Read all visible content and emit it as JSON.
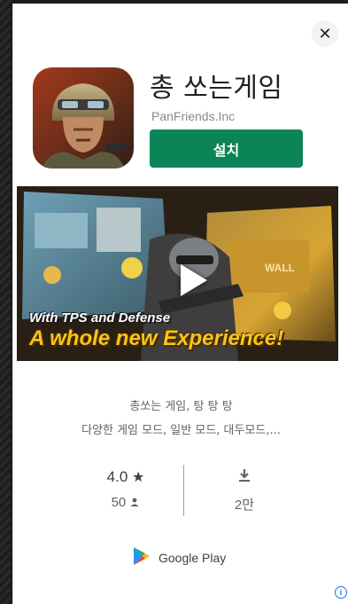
{
  "ad": {
    "close_glyph": "✕",
    "app_title": "총 쏘는게임",
    "developer": "PanFriends.Inc",
    "install_label": "설치",
    "video": {
      "tagline_line1": "With TPS and Defense",
      "tagline_line2": "A whole new Experience!"
    },
    "description_line1": "총쏘는 게임, 탕 탕 탕",
    "description_line2": "다양한 게임 모드, 일반 모드, 대두모드,...",
    "rating_value": "4.0",
    "rating_count": "50",
    "downloads": "2만",
    "store_label": "Google Play",
    "info_glyph": "i"
  },
  "colors": {
    "install_green": "#0b8558",
    "info_blue": "#1a73e8",
    "page_background": "#1c1c1c"
  },
  "icons": [
    "close-icon",
    "star-icon",
    "person-icon",
    "download-icon",
    "google-play-logo-icon",
    "info-icon",
    "play-icon"
  ]
}
